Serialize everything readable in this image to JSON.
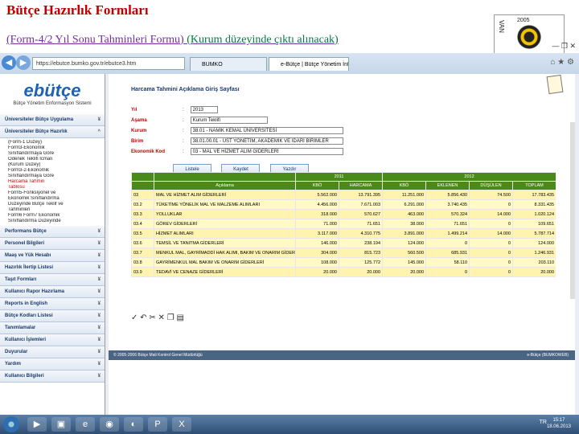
{
  "slide": {
    "title": "Bütçe Hazırlık Formları",
    "subtitle_main": "(Form-4/2 Yıl Sonu Tahminleri Formu)",
    "subtitle_note": "(Kurum düzeyinde çıktı alınacak)",
    "logo_text": "2005",
    "logo_side": "VAN"
  },
  "browser": {
    "address": "https://ebutce.bumko.gov.tr/ebutce3.htm",
    "tabs": [
      "BUMKO",
      "e-Bütçe | Bütçe Yönetim İnf..."
    ],
    "toolbar_icons": "⌂ ★ ⚙",
    "window_buttons": "— ❐ ✕"
  },
  "sidebar": {
    "logo_main": "ebütçe",
    "logo_sub": "Bütçe Yönetim Enformasyon Sistemi",
    "sections": [
      "Üniversiteler Bütçe Uygulama",
      "Üniversiteler Bütçe Hazırlık",
      "Performans Bütçe",
      "Personel Bilgileri",
      "Maaş ve Yük Hesabı",
      "Hazırlık İlertip Listesi",
      "Taşıt Formları",
      "Kullanıcı Rapor Hazırlama",
      "Reports in English",
      "Bütçe Kodları Listesi",
      "Tanımlamalar",
      "Kullanıcı İşlemleri",
      "Duyurular",
      "Yardım",
      "Kullanıcı Bilgileri"
    ],
    "sub_items": [
      "(Form-1 Düzey)",
      "Form3-Ekonomik",
      "Sınıflandırmaya Göre",
      "Ödenek Teklifi İcmali",
      "(Kurum Düzey)",
      "Form3-2-Ekonomik",
      "Sınıflandırmaya Göre",
      "Harcama Tahmin",
      "Tablosu",
      "Form5-Fonksiyonel ve",
      "Ekonomik Sınıflandırma",
      "Düzeyinde Bütçe Teklif ve",
      "Tahminleri",
      "Form6 Form7 Ekonomik",
      "Sınıflandırma Düzeyinde"
    ]
  },
  "form": {
    "heading": "Harcama Tahmini Açıklama Giriş Sayfası",
    "fields": [
      {
        "label": "Yıl",
        "value": "2013"
      },
      {
        "label": "Aşama",
        "value": "Kurum Teklifi"
      },
      {
        "label": "Kurum",
        "value": "38.01 - NAMIK KEMAL ÜNİVERSİTESİ"
      },
      {
        "label": "Birim",
        "value": "38.01.00.01 - ÜST YÖNETİM, AKADEMİK VE İDARİ BİRİMLER"
      },
      {
        "label": "Ekonomik Kod",
        "value": "03 - MAL VE HİZMET ALIM GİDERLERİ"
      }
    ],
    "buttons": [
      "Listele",
      "Kaydet",
      "Yazdır"
    ]
  },
  "table": {
    "year_left": "2011",
    "year_right": "2012",
    "headers": [
      "",
      "Açıklama",
      "KBÖ",
      "HARCAMA",
      "KBÖ",
      "EKLENEN",
      "DÜŞÜLEN",
      "TOPLAM"
    ],
    "rows": [
      [
        "03",
        "MAL VE HİZMET ALIM GİDERLERİ",
        "5.562.000",
        "13.791.395",
        "11.251.000",
        "5.856.430",
        "74.500",
        "17.783.435"
      ],
      [
        "03.2",
        "TÜKETİME YÖNELİK MAL VE MALZEME ALIMLARI",
        "4.456.000",
        "7.671.003",
        "6.291.000",
        "3.740.435",
        "0",
        "8.331.435"
      ],
      [
        "03.3",
        "YOLLUKLAR",
        "318.000",
        "570.627",
        "463.000",
        "570.324",
        "14.000",
        "1.020.124"
      ],
      [
        "03.4",
        "GÖREV GİDERLERİ",
        "71.000",
        "71.651",
        "38.000",
        "71.651",
        "0",
        "109.651"
      ],
      [
        "03.5",
        "HİZMET ALIMLARI",
        "3.117.000",
        "4.310.775",
        "3.891.000",
        "1.499.214",
        "14.000",
        "5.787.714"
      ],
      [
        "03.6",
        "TEMSİL VE TANITMA GİDERLERİ",
        "146.000",
        "238.194",
        "124.000",
        "0",
        "0",
        "124.000"
      ],
      [
        "03.7",
        "MENKUL MAL, GAYRİMADDİ HAK ALIMI, BAKIM VE ONARIM GİDERLERİ",
        "304.000",
        "815.723",
        "560.500",
        "685.931",
        "0",
        "1.246.931"
      ],
      [
        "03.8",
        "GAYRİMENKUL MAL BAKIM VE ONARIM GİDERLERİ",
        "108.000",
        "125.772",
        "145.000",
        "58.110",
        "0",
        "203.110"
      ],
      [
        "03.9",
        "TEDAVİ VE CENAZE GİDERLERİ",
        "20.000",
        "20.000",
        "20.000",
        "0",
        "0",
        "20.000"
      ]
    ],
    "footer_left": "© 2005-2006 Bütçe Mali Kontrol Genel Müdürlüğü",
    "footer_right": "e-Bütçe (BUMKOWEB)"
  },
  "taskbar": {
    "tray": "TR",
    "time": "15:17",
    "date": "18.06.2013"
  }
}
